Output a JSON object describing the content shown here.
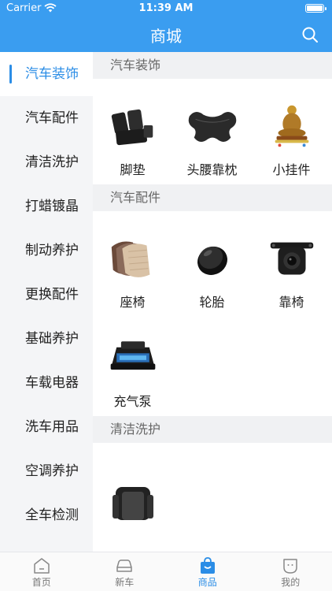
{
  "status": {
    "carrier": "Carrier",
    "time": "11:39 AM"
  },
  "header": {
    "title": "商城"
  },
  "sidebar": {
    "items": [
      {
        "label": "汽车装饰"
      },
      {
        "label": "汽车配件"
      },
      {
        "label": "清洁洗护"
      },
      {
        "label": "打蜡镀晶"
      },
      {
        "label": "制动养护"
      },
      {
        "label": "更换配件"
      },
      {
        "label": "基础养护"
      },
      {
        "label": "车载电器"
      },
      {
        "label": "洗车用品"
      },
      {
        "label": "空调养护"
      },
      {
        "label": "全车检测"
      }
    ]
  },
  "content": {
    "sections": [
      {
        "title": "汽车装饰",
        "items": [
          "脚垫",
          "头腰靠枕",
          "小挂件"
        ]
      },
      {
        "title": "汽车配件",
        "items": [
          "座椅",
          "轮胎",
          "靠椅",
          "充气泵"
        ]
      },
      {
        "title": "清洁洗护",
        "items": []
      }
    ]
  },
  "tabbar": {
    "items": [
      {
        "label": "首页"
      },
      {
        "label": "新车"
      },
      {
        "label": "商品"
      },
      {
        "label": "我的"
      }
    ]
  },
  "colors": {
    "accent": "#2b8de6",
    "header": "#3a9df0"
  }
}
